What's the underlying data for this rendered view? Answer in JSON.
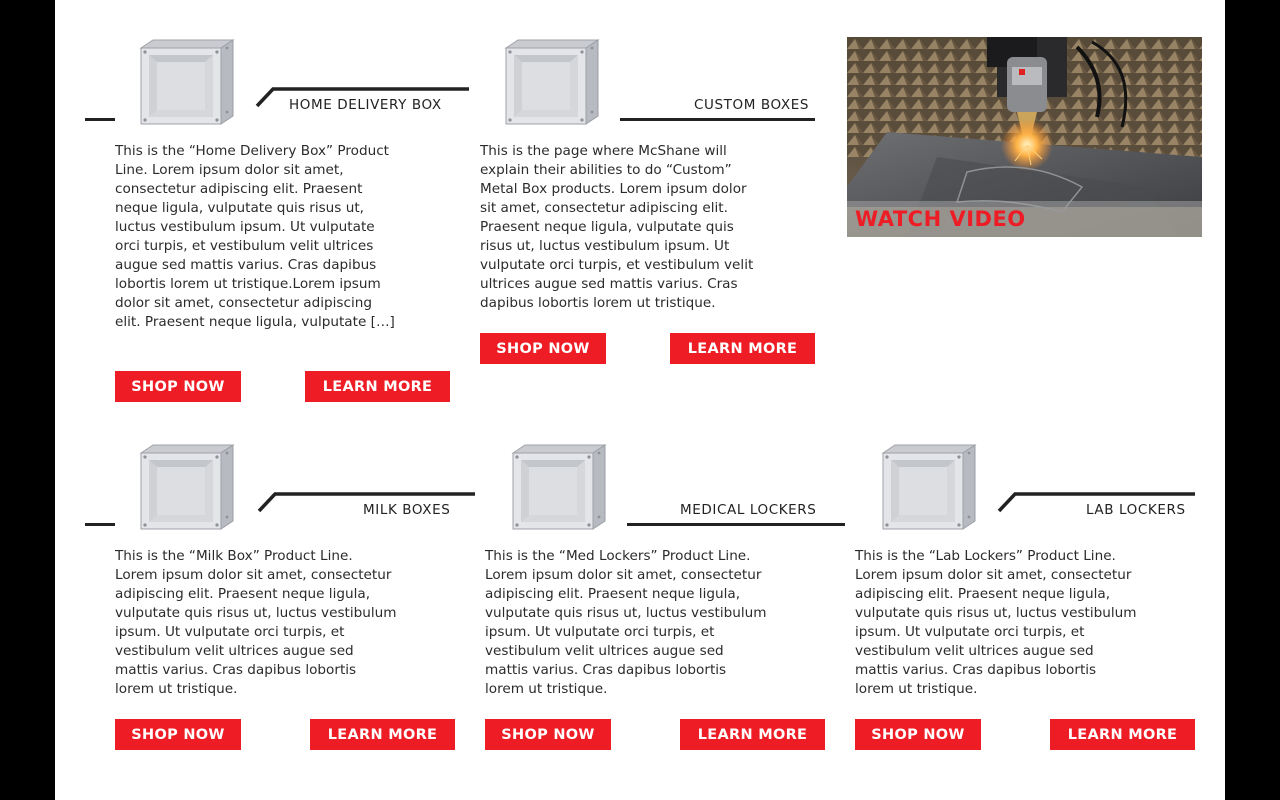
{
  "products": [
    {
      "title": "HOME DELIVERY BOX",
      "description": "This is the “Home Delivery Box” Product Line. Lorem ipsum dolor sit amet, consectetur adipiscing elit. Praesent neque ligula, vulputate quis risus ut, luctus vestibulum ipsum. Ut vulputate orci turpis, et vestibulum velit ultrices augue sed mattis varius. Cras dapibus lobortis lorem ut tristique.Lorem ipsum dolor sit amet, consectetur adipiscing elit. Praesent neque ligula, vulputate […]",
      "shop_label": "SHOP NOW",
      "learn_label": "LEARN MORE",
      "image_icon": "metal-box-icon"
    },
    {
      "title": "CUSTOM BOXES",
      "description": "This is the page where McShane will explain their abilities to do “Custom” Metal Box products. Lorem ipsum dolor sit amet, consectetur adipiscing elit. Praesent neque ligula, vulputate quis risus ut, luctus vestibulum ipsum. Ut vulputate orci turpis, et vestibulum velit ultrices augue sed mattis varius. Cras dapibus lobortis lorem ut tristique.",
      "shop_label": "SHOP NOW",
      "learn_label": "LEARN MORE",
      "image_icon": "metal-box-icon"
    },
    {
      "title": "MILK BOXES",
      "description": "This is the “Milk Box” Product Line. Lorem ipsum dolor sit amet, consectetur adipiscing elit. Praesent neque ligula, vulputate quis risus ut, luctus vestibulum ipsum. Ut vulputate orci turpis, et vestibulum velit ultrices augue sed mattis varius. Cras dapibus lobortis lorem ut tristique.",
      "shop_label": "SHOP NOW",
      "learn_label": "LEARN MORE",
      "image_icon": "metal-box-icon"
    },
    {
      "title": "MEDICAL LOCKERS",
      "description": "This is the “Med Lockers” Product Line. Lorem ipsum dolor sit amet, consectetur adipiscing elit. Praesent neque ligula, vulputate quis risus ut, luctus vestibulum ipsum. Ut vulputate orci turpis, et vestibulum velit ultrices augue sed mattis varius. Cras dapibus lobortis lorem ut tristique.",
      "shop_label": "SHOP NOW",
      "learn_label": "LEARN MORE",
      "image_icon": "metal-box-icon"
    },
    {
      "title": "LAB LOCKERS",
      "description": "This is the “Lab Lockers” Product Line. Lorem ipsum dolor sit amet, consectetur adipiscing elit. Praesent neque ligula, vulputate quis risus ut, luctus vestibulum ipsum. Ut vulputate orci turpis, et vestibulum velit ultrices augue sed mattis varius. Cras dapibus lobortis lorem ut tristique.",
      "shop_label": "SHOP NOW",
      "learn_label": "LEARN MORE",
      "image_icon": "metal-box-icon"
    }
  ],
  "video": {
    "label": "WATCH VIDEO",
    "image_icon": "laser-cutting-image"
  },
  "colors": {
    "accent": "#ee1c25",
    "text": "#2b2b2b",
    "rule": "#222222",
    "frame": "#000000",
    "page": "#ffffff"
  }
}
